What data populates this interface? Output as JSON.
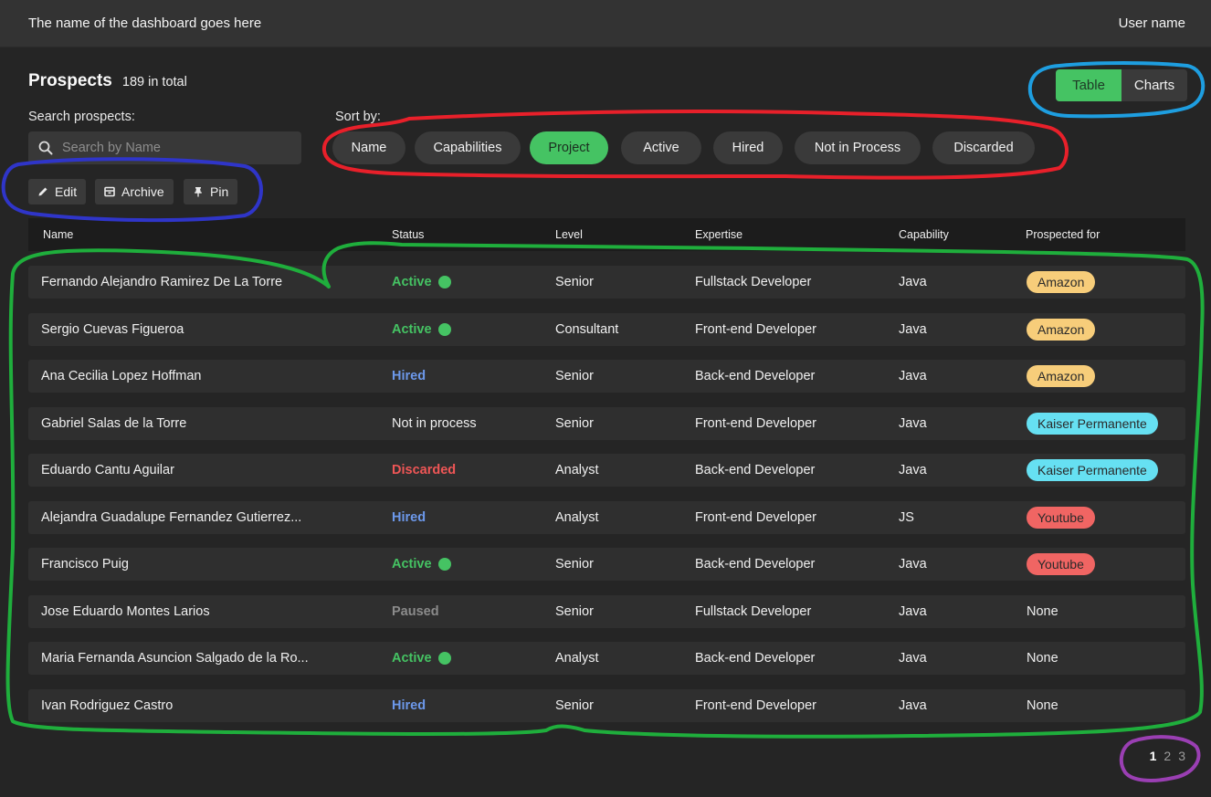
{
  "header": {
    "title": "The name  of the dashboard goes here",
    "user": "User name"
  },
  "page": {
    "title": "Prospects",
    "count": "189 in total"
  },
  "view_toggle": {
    "table": "Table",
    "charts": "Charts",
    "selected": "Table"
  },
  "search": {
    "label": "Search prospects:",
    "placeholder": "Search by Name",
    "value": ""
  },
  "sort": {
    "label": "Sort by:",
    "options": [
      "Name",
      "Capabilities",
      "Project",
      "Active",
      "Hired",
      "Not in Process",
      "Discarded"
    ],
    "selected": "Project"
  },
  "toolbar": {
    "edit": "Edit",
    "archive": "Archive",
    "pin": "Pin"
  },
  "table": {
    "columns": [
      "Name",
      "Status",
      "Level",
      "Expertise",
      "Capability",
      "Prospected for"
    ],
    "rows": [
      {
        "name": "Fernando Alejandro Ramirez De La Torre",
        "status": "Active",
        "level": "Senior",
        "expertise": "Fullstack Developer",
        "capability": "Java",
        "project": "Amazon"
      },
      {
        "name": "Sergio Cuevas Figueroa",
        "status": "Active",
        "level": "Consultant",
        "expertise": "Front-end Developer",
        "capability": "Java",
        "project": "Amazon"
      },
      {
        "name": "Ana Cecilia Lopez Hoffman",
        "status": "Hired",
        "level": "Senior",
        "expertise": "Back-end Developer",
        "capability": "Java",
        "project": "Amazon"
      },
      {
        "name": "Gabriel Salas de la Torre",
        "status": "Not in process",
        "level": "Senior",
        "expertise": "Front-end Developer",
        "capability": "Java",
        "project": "Kaiser Permanente"
      },
      {
        "name": "Eduardo Cantu Aguilar",
        "status": "Discarded",
        "level": "Analyst",
        "expertise": "Back-end Developer",
        "capability": "Java",
        "project": "Kaiser Permanente"
      },
      {
        "name": "Alejandra Guadalupe Fernandez Gutierrez...",
        "status": "Hired",
        "level": "Analyst",
        "expertise": "Front-end Developer",
        "capability": "JS",
        "project": "Youtube"
      },
      {
        "name": "Francisco Puig",
        "status": "Active",
        "level": "Senior",
        "expertise": "Back-end Developer",
        "capability": "Java",
        "project": "Youtube"
      },
      {
        "name": "Jose Eduardo Montes Larios",
        "status": "Paused",
        "level": "Senior",
        "expertise": "Fullstack Developer",
        "capability": "Java",
        "project": "None"
      },
      {
        "name": "Maria Fernanda Asuncion Salgado de la Ro...",
        "status": "Active",
        "level": "Analyst",
        "expertise": "Back-end Developer",
        "capability": "Java",
        "project": "None"
      },
      {
        "name": "Ivan Rodriguez Castro",
        "status": "Hired",
        "level": "Senior",
        "expertise": "Front-end Developer",
        "capability": "Java",
        "project": "None"
      }
    ]
  },
  "pagination": {
    "pages": [
      "1",
      "2",
      "3"
    ],
    "current": "1"
  },
  "colors": {
    "accent_green": "#45c363",
    "hired_blue": "#6c98ea",
    "discarded_red": "#ef5656",
    "paused_gray": "#8b8b8b",
    "tag_amazon": "#f7cd7a",
    "tag_kaiser": "#66e0f2",
    "tag_youtube": "#f06563",
    "annotation_red": "#e8202a",
    "annotation_blue": "#1e9ee0",
    "annotation_navy": "#2f35c9",
    "annotation_green": "#1fae3c",
    "annotation_purple": "#9a3fb3"
  }
}
